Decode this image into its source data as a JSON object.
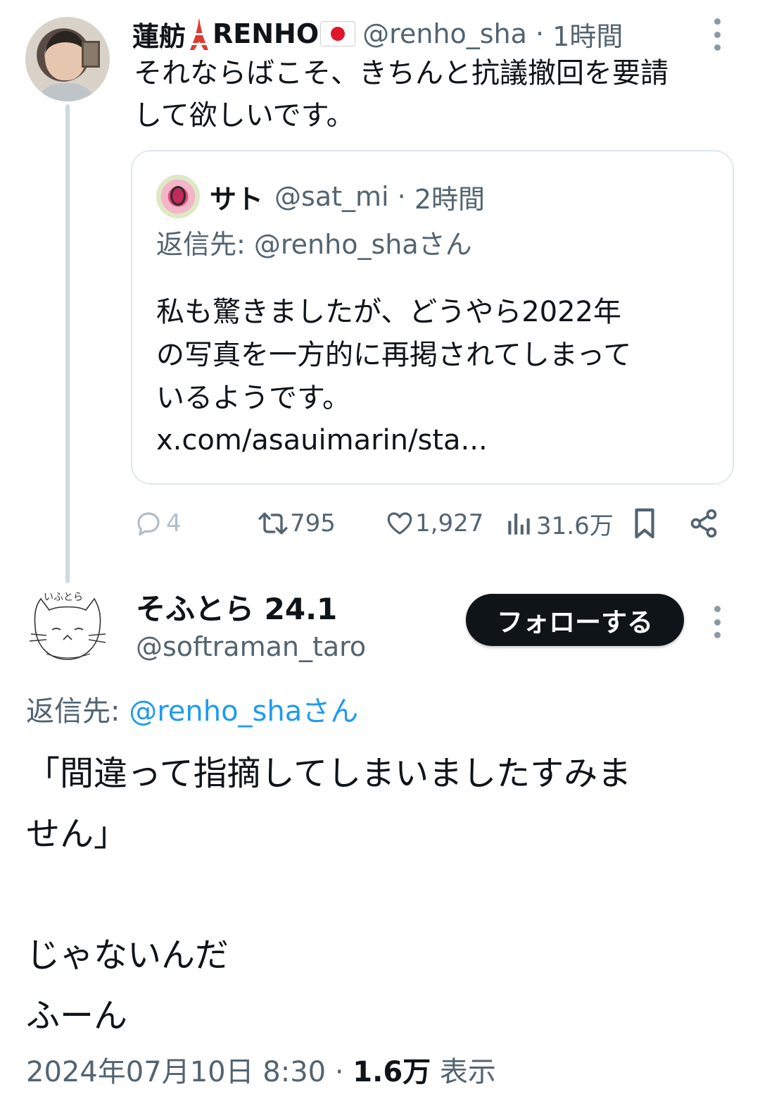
{
  "parent_tweet": {
    "display_name": "蓮舫",
    "display_name_suffix": "RENHO",
    "emoji_1": "tokyo-tower",
    "emoji_2": "japan-flag",
    "handle": "@renho_sha",
    "separator": " · ",
    "time": "1時間",
    "text": "それならばこそ、きちんと抗議撤回を要請\nして欲しいです。",
    "quote": {
      "display_name": "サト",
      "handle": "@sat_mi",
      "separator": " · ",
      "time": "2時間",
      "reply_prefix": "返信先: ",
      "reply_to": "@renho_shaさん",
      "text": "私も驚きましたが、どうやら2022年\nの写真を一方的に再掲されてしまって\nいるようです。",
      "link": "x.com/asauimarin/sta..."
    },
    "actions": {
      "replies": "4",
      "reposts": "795",
      "likes": "1,927",
      "views": "31.6万"
    }
  },
  "main_tweet": {
    "display_name": "そふとら 24.1",
    "handle": "@softraman_taro",
    "follow_label": "フォローする",
    "reply_prefix": "返信先: ",
    "reply_to": "@renho_shaさん",
    "text": "「間違って指摘してしまいましたすみま\nせん」\n\nじゃないんだ\nふーん",
    "timestamp": "2024年07月10日 8:30",
    "separator": " · ",
    "view_count": "1.6万",
    "view_label": " 表示"
  },
  "colors": {
    "text": "#0f1419",
    "muted": "#536471",
    "link": "#1d9bf0",
    "border": "#e1e8ed",
    "thread_line": "#cfd9de",
    "button_bg": "#0f1419"
  }
}
